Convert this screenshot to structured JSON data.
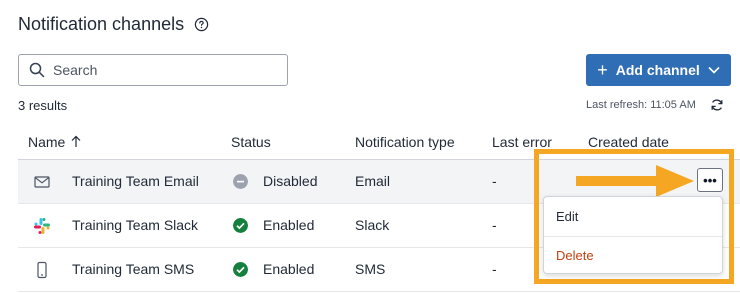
{
  "header": {
    "title": "Notification channels",
    "help_icon": "question-circle-icon"
  },
  "search": {
    "placeholder": "Search",
    "value": "",
    "icon": "search-icon"
  },
  "toolbar": {
    "add_label": "Add channel",
    "add_icon": "plus-icon",
    "chevron_icon": "chevron-down-icon",
    "accent": "#2f6db5"
  },
  "results_text": "3 results",
  "refresh": {
    "text": "Last refresh: 11:05 AM",
    "icon": "refresh-icon"
  },
  "table": {
    "columns": [
      "Name",
      "Status",
      "Notification type",
      "Last error",
      "Created date"
    ],
    "sort_icon": "arrow-up-icon",
    "rows": [
      {
        "icon": "email-icon",
        "name": "Training Team Email",
        "status_icon": "disabled-icon",
        "status": "Disabled",
        "type": "Email",
        "last_error": "-"
      },
      {
        "icon": "slack-icon",
        "name": "Training Team Slack",
        "status_icon": "enabled-check-icon",
        "status": "Enabled",
        "type": "Slack",
        "last_error": "-"
      },
      {
        "icon": "mobile-icon",
        "name": "Training Team SMS",
        "status_icon": "enabled-check-icon",
        "status": "Enabled",
        "type": "SMS",
        "last_error": "-"
      }
    ]
  },
  "row_actions": {
    "more_label": "•••",
    "menu": {
      "edit": "Edit",
      "delete": "Delete"
    }
  },
  "colors": {
    "enabled": "#15803d",
    "disabled": "#9ca3af",
    "delete": "#c2410c",
    "highlight": "#f5a623"
  }
}
